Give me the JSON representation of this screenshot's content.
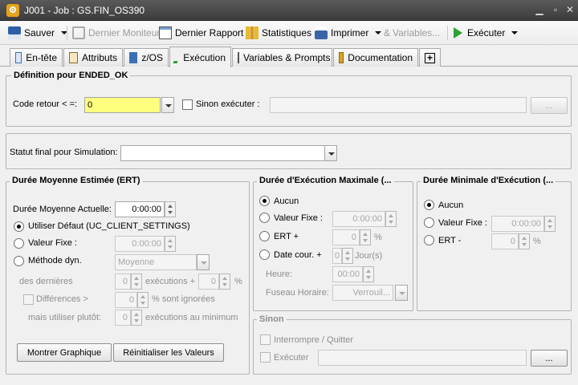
{
  "window": {
    "title": "J001 - Job : GS.FIN_OS390",
    "icon": "job-icon"
  },
  "toolbar": {
    "save": "Sauver",
    "last_monitor": "Dernier Moniteur",
    "last_report": "Dernier Rapport",
    "statistics": "Statistiques",
    "print": "Imprimer",
    "variables": "Variables...",
    "execute": "Exécuter"
  },
  "tabs": [
    {
      "label": "En-tête"
    },
    {
      "label": "Attributs"
    },
    {
      "label": "z/OS"
    },
    {
      "label": "Exécution"
    },
    {
      "label": "Variables & Prompts"
    },
    {
      "label": "Documentation"
    },
    {
      "label": "+"
    }
  ],
  "definition": {
    "title": "Définition pour ENDED_OK",
    "return_code_label": "Code retour < =:",
    "return_code_value": "0",
    "else_execute_label": "Sinon exécuter :",
    "browse": "..."
  },
  "simulation": {
    "label": "Statut final pour Simulation:",
    "value": ""
  },
  "ert": {
    "title": "Durée Moyenne Estimée (ERT)",
    "current_label": "Durée Moyenne Actuelle:",
    "current_value": "0:00:00",
    "default_label": "Utiliser Défaut (UC_CLIENT_SETTINGS)",
    "fixed_label": "Valeur Fixe :",
    "fixed_value": "0:00:00",
    "dyn_label": "Méthode dyn.",
    "dyn_value": "Moyenne",
    "last_label": "des dernières",
    "last_value": "0",
    "exec_plus": "exécutions +",
    "pct_value": "0",
    "pct": "%",
    "diff_label": "Différences >",
    "diff_value": "0",
    "ignored": "% sont ignorées",
    "but_use": "mais utiliser plutôt:",
    "min_value": "0",
    "exec_min": "exécutions au minimum",
    "show_graph": "Montrer Graphique",
    "reset": "Réinitialiser les Valeurs",
    "selected": "default"
  },
  "max_runtime": {
    "title": "Durée d'Exécution Maximale (...",
    "none": "Aucun",
    "fixed": "Valeur Fixe :",
    "fixed_value": "0:00:00",
    "ert_plus": "ERT +",
    "ert_value": "0",
    "pct": "%",
    "date_label": "Date cour. +",
    "date_value": "0",
    "days": "Jour(s)",
    "hour_label": "Heure:",
    "hour_value": "00:00",
    "tz_label": "Fuseau Horaire:",
    "tz_value": "Verrouil...",
    "selected": "none"
  },
  "min_runtime": {
    "title": "Durée Minimale d'Exécution (...",
    "none": "Aucun",
    "fixed": "Valeur Fixe :",
    "fixed_value": "0:00:00",
    "ert_minus": "ERT -",
    "ert_value": "0",
    "pct": "%",
    "selected": "none"
  },
  "else": {
    "title": "Sinon",
    "abort": "Interrompre / Quitter",
    "execute": "Exécuter",
    "browse": "..."
  }
}
